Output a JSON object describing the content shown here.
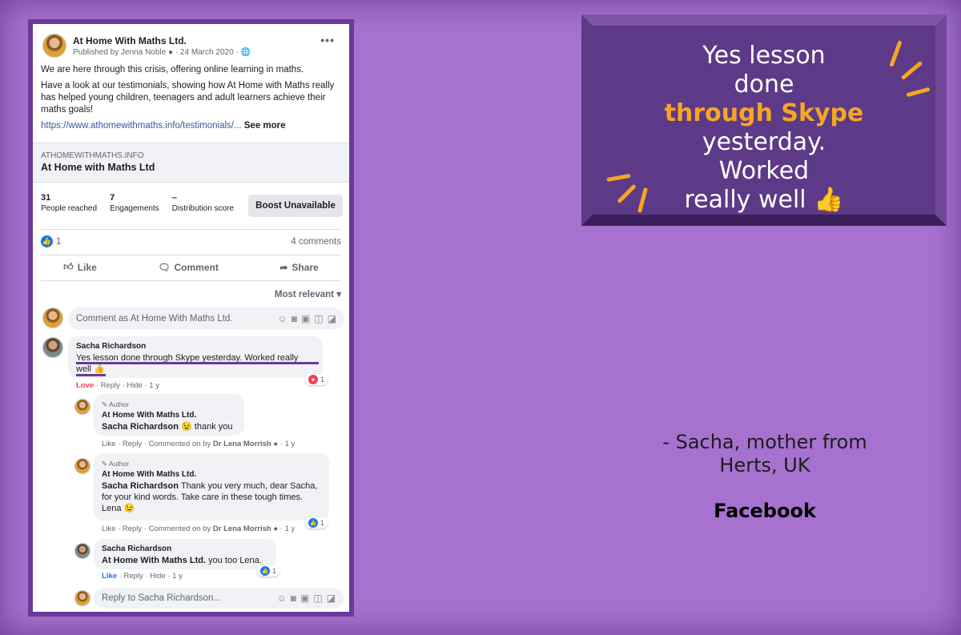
{
  "post": {
    "page_name": "At Home With Maths Ltd.",
    "published_by": "Published by Jenna Noble",
    "date": "24 March 2020",
    "para1": "We are here through this crisis, offering online learning in maths.",
    "para2": "Have a look at our testimonials, showing how At Home with Maths really has helped young children, teenagers and adult learners achieve their maths goals!",
    "link": "https://www.athomewithmaths.info/testimonials/...",
    "see_more": "See more",
    "more_icon": "more-icon"
  },
  "link_preview": {
    "domain": "ATHOMEWITHMATHS.INFO",
    "title": "At Home with Maths Ltd"
  },
  "stats": [
    {
      "num": "31",
      "label": "People reached"
    },
    {
      "num": "7",
      "label": "Engagements"
    },
    {
      "num": "–",
      "label": "Distribution score"
    }
  ],
  "boost_label": "Boost Unavailable",
  "reactions": {
    "count": "1",
    "comments": "4 comments"
  },
  "actions": {
    "like": "Like",
    "comment": "Comment",
    "share": "Share"
  },
  "sort_label": "Most relevant",
  "comment_placeholder": "Comment as At Home With Maths Ltd.",
  "comments": [
    {
      "name": "Sacha Richardson",
      "text": "Yes lesson done through Skype yesterday. Worked really well",
      "emoji": "👍",
      "meta_a": "Love",
      "meta_b": "· Reply · Hide · 1 y",
      "react": "1"
    },
    {
      "author": "Author",
      "name": "At Home With Maths Ltd.",
      "mention": "Sacha Richardson",
      "text": "😉 thank you",
      "meta_a": "Like · Reply · Commented on by",
      "meta_person": "Dr Lena Morrish",
      "meta_b": "· 1 y"
    },
    {
      "author": "Author",
      "name": "At Home With Maths Ltd.",
      "mention": "Sacha Richardson",
      "text": "Thank you very much, dear Sacha, for your kind words. Take care in these tough times. Lena 😉",
      "meta_a": "Like · Reply · Commented on by",
      "meta_person": "Dr Lena Morrish",
      "meta_b": "· 1 y",
      "react": "1"
    },
    {
      "name": "Sacha Richardson",
      "mention": "At Home With Maths Ltd.",
      "text": "you too Lena.",
      "meta_a": "Like",
      "meta_b": "· Reply · Hide · 1 y",
      "react": "1"
    }
  ],
  "reply_placeholder": "Reply to Sacha Richardson...",
  "quote": {
    "line1": "Yes lesson",
    "line2": "done",
    "line3": "through Skype",
    "line4": "yesterday.",
    "line5": "Worked",
    "line6": "really well",
    "emoji": "👍"
  },
  "attribution": {
    "line1": "- Sacha, mother from",
    "line2": "Herts, UK"
  },
  "source": "Facebook",
  "colors": {
    "background": "#a772cf",
    "panel": "#5d3a87",
    "accent": "#f5a623",
    "fb_blue": "#1877f2"
  }
}
